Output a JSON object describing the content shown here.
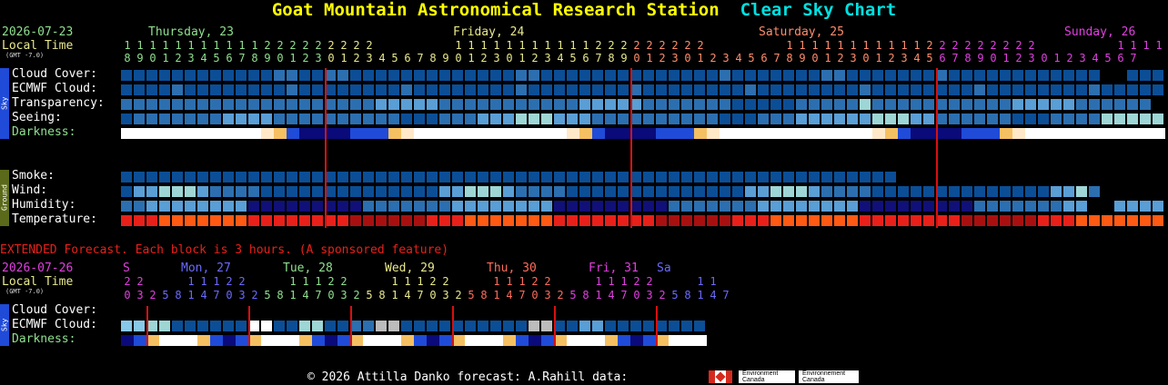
{
  "header": {
    "title_station": "Goat Mountain Astronomical Research Station",
    "title_chart": "Clear Sky Chart",
    "station_color": "#ffff00",
    "chart_color": "#00e0e0"
  },
  "main": {
    "date": "2026-07-23",
    "local_time_label": "Local Time",
    "gmt_label": "(GMT -7.0)",
    "days": [
      {
        "label": "Thursday, 23",
        "color": "#8fe08f"
      },
      {
        "label": "Friday, 24",
        "color": "#e8e88c"
      },
      {
        "label": "Saturday, 25",
        "color": "#ff8c6c"
      },
      {
        "label": "Sunday, 26",
        "color": "#e040e0"
      }
    ],
    "hour_tens": "11111111111222222222      11111111111222222222      11111111111222222222      1111111",
    "hour_digits": "89012345678901230123456789012301234567890123012345678901230123456789012301234567",
    "sky_tag": "Sky",
    "ground_tag": "Ground",
    "rows": [
      {
        "label": "Cloud Cover:",
        "color": "#ffffff"
      },
      {
        "label": "ECMWF Cloud:",
        "color": "#ffffff"
      },
      {
        "label": "Transparency:",
        "color": "#ffffff"
      },
      {
        "label": "Seeing:",
        "color": "#ffffff"
      },
      {
        "label": "Darkness:",
        "color": "#8fe08f"
      },
      {
        "label": "Smoke:",
        "color": "#ffffff"
      },
      {
        "label": "Wind:",
        "color": "#ffffff"
      },
      {
        "label": "Humidity:",
        "color": "#ffffff"
      },
      {
        "label": "Temperature:",
        "color": "#ffffff"
      }
    ]
  },
  "extended": {
    "note": "EXTENDED Forecast. Each block is 3 hours. (A sponsored feature)",
    "date": "2026-07-26",
    "local_time_label": "Local Time",
    "gmt_label": "(GMT -7.0)",
    "days": [
      {
        "label": "S",
        "color": "#e040e0"
      },
      {
        "label": "Mon, 27",
        "color": "#6a6aff"
      },
      {
        "label": "Tue, 28",
        "color": "#8fe08f"
      },
      {
        "label": "Wed, 29",
        "color": "#e8e88c"
      },
      {
        "label": "Thu, 30",
        "color": "#ff6c5c"
      },
      {
        "label": "Fri, 31",
        "color": "#e040e0"
      },
      {
        "label": "Sa",
        "color": "#6a6aff"
      }
    ],
    "hour_tens": "22   11122   11122   11122   11122   11122   11",
    "hour_digits": "032581470325814703258147032581470325814703258147",
    "sky_tag": "Sky",
    "rows": [
      {
        "label": "Cloud Cover:",
        "color": "#ffffff"
      },
      {
        "label": "ECMWF Cloud:",
        "color": "#ffffff"
      },
      {
        "label": "Darkness:",
        "color": "#8fe08f"
      }
    ]
  },
  "footer": {
    "credit": "© 2026 Attilla Danko  forecast: A.Rahill  data:",
    "env_canada_1": "Environment Canada",
    "env_canada_2": "Environnement Canada"
  },
  "palette": {
    "clear": "#0b4e96",
    "mid": "#2c6fb0",
    "light": "#5a9ed6",
    "pale": "#88c8e8",
    "teal": "#9ed6d6",
    "white": "#ffffff",
    "grey": "#bcbcbc",
    "hum_dark": "#101078",
    "temp_red": "#e8201a",
    "temp_orange": "#ff5a14",
    "temp_dark": "#a81010",
    "dark_night": "#0a0a7a",
    "dark_blue": "#1f4bd8",
    "dark_gold": "#f5c062",
    "midnight_line": "#d81010"
  }
}
